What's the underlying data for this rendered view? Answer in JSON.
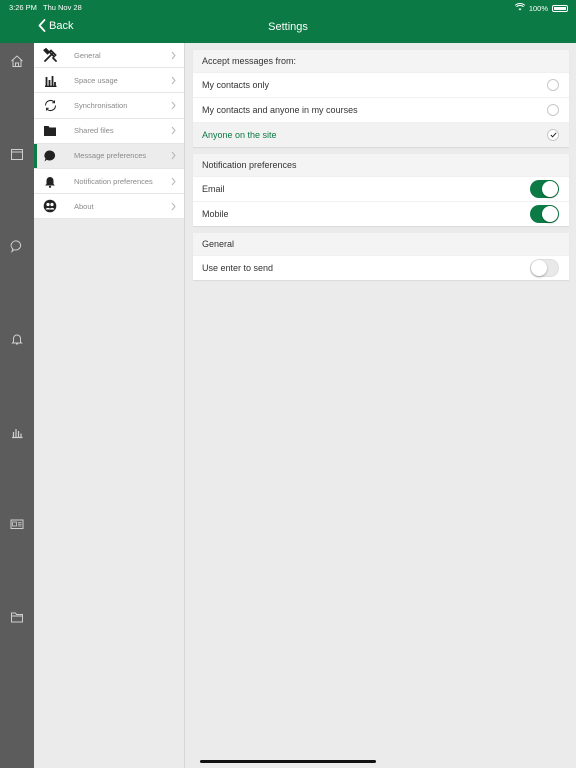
{
  "status_bar": {
    "time": "3:26 PM",
    "date": "Thu Nov 28",
    "battery": "100%"
  },
  "header": {
    "back_label": "Back",
    "title": "Settings"
  },
  "colors": {
    "brand": "#0b7a44",
    "rail": "#5c5c5c"
  },
  "rail_icons": [
    "home-icon",
    "calendar-icon",
    "chat-icon",
    "bell-icon",
    "grades-icon",
    "badge-icon",
    "folder-icon"
  ],
  "menu": {
    "items": [
      {
        "label": "General",
        "icon": "wrench-icon"
      },
      {
        "label": "Space usage",
        "icon": "bar-chart-icon"
      },
      {
        "label": "Synchronisation",
        "icon": "sync-icon"
      },
      {
        "label": "Shared files",
        "icon": "folder-icon"
      },
      {
        "label": "Message preferences",
        "icon": "speech-bubble-icon",
        "active": true
      },
      {
        "label": "Notification preferences",
        "icon": "bell-icon"
      },
      {
        "label": "About",
        "icon": "users-icon"
      }
    ]
  },
  "accept": {
    "heading": "Accept messages from:",
    "options": [
      {
        "label": "My contacts only",
        "selected": false
      },
      {
        "label": "My contacts and anyone in my courses",
        "selected": false
      },
      {
        "label": "Anyone on the site",
        "selected": true
      }
    ]
  },
  "notifications": {
    "heading": "Notification preferences",
    "items": [
      {
        "label": "Email",
        "on": true
      },
      {
        "label": "Mobile",
        "on": true
      }
    ]
  },
  "general": {
    "heading": "General",
    "items": [
      {
        "label": "Use enter to send",
        "on": false
      }
    ]
  }
}
